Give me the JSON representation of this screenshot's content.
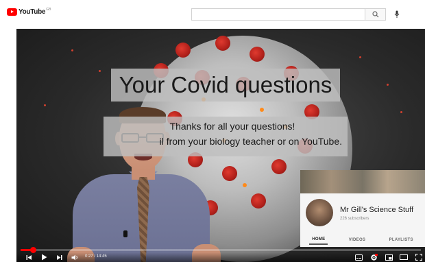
{
  "header": {
    "logo_text": "YouTube",
    "region_code": "GB",
    "search_placeholder": ""
  },
  "video": {
    "title_overlay": "Your Covid questions",
    "subtitle_line1": "Thanks for all your questions!",
    "subtitle_line2": "il from your biology teacher or on YouTube.",
    "progress_fraction": 0.031
  },
  "player_controls": {
    "current_time": "0:27",
    "duration": "14:45",
    "time_separator": " / "
  },
  "end_card": {
    "channel_name": "Mr Gill's Science Stuff",
    "subscribers": "226 subscribers",
    "tabs": [
      {
        "label": "HOME",
        "active": true
      },
      {
        "label": "VIDEOS",
        "active": false
      },
      {
        "label": "PLAYLISTS",
        "active": false
      }
    ]
  },
  "colors": {
    "brand_red": "#ff0000",
    "overlay_gray": "#bebebe"
  },
  "icons": [
    "youtube-logo-icon",
    "search-icon",
    "microphone-icon",
    "previous-icon",
    "play-icon",
    "next-icon",
    "volume-icon",
    "subtitles-icon",
    "settings-icon",
    "miniplayer-icon",
    "theater-icon",
    "fullscreen-icon"
  ]
}
